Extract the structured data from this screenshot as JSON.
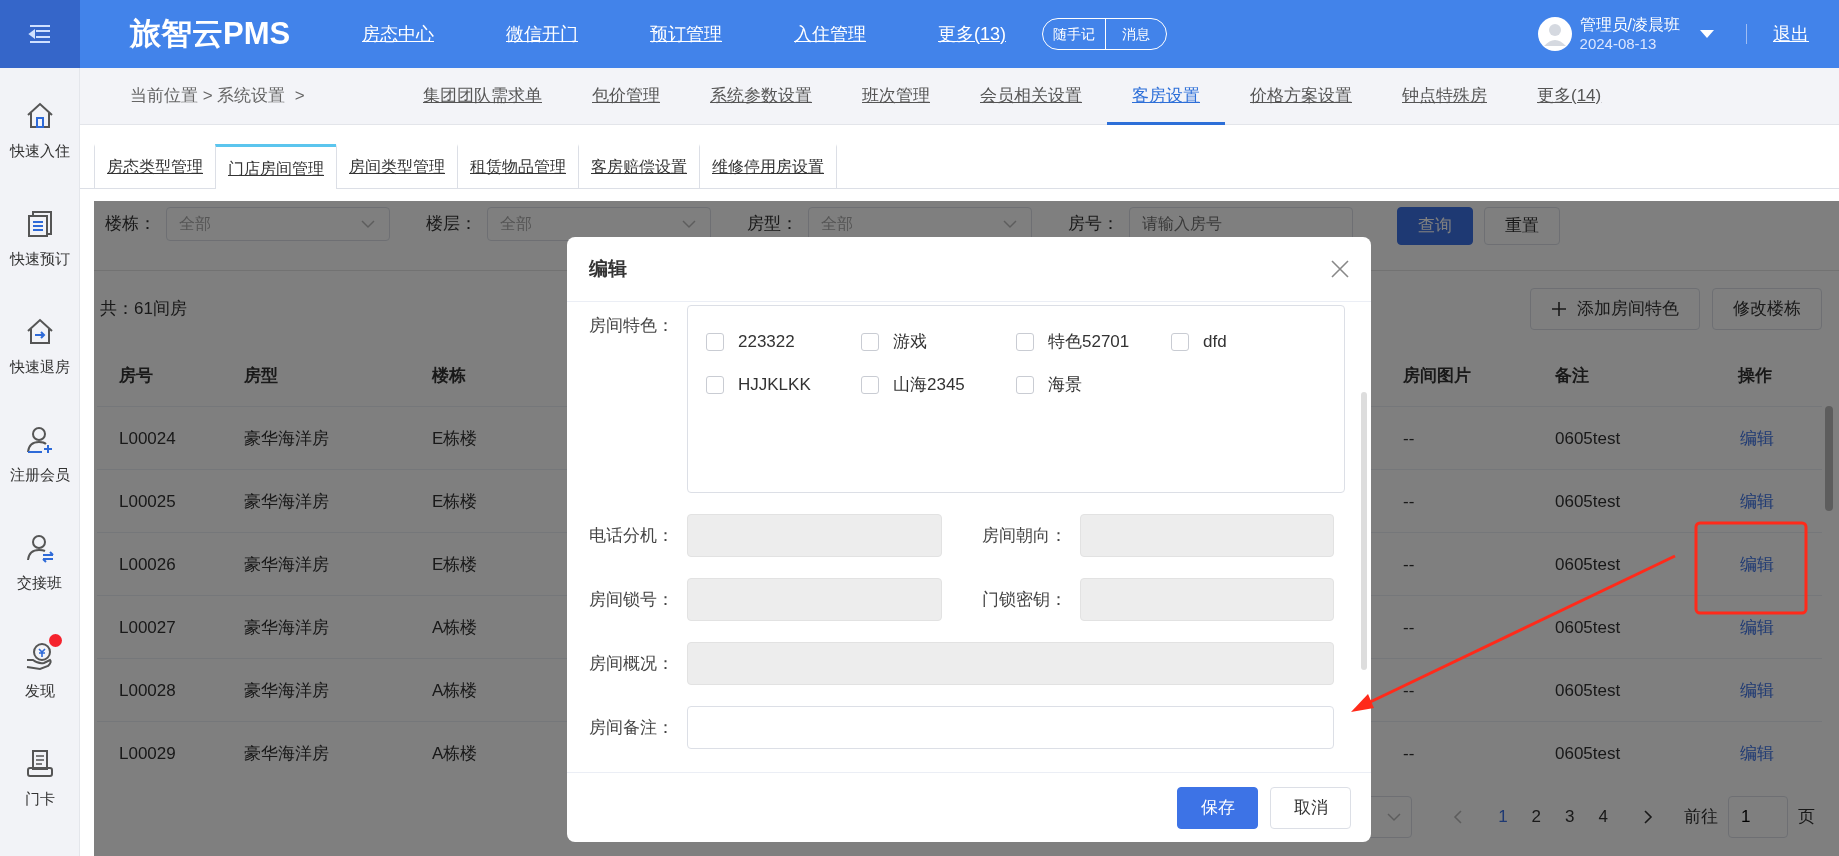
{
  "top_bar": {
    "logo": "旅智云PMS",
    "nav": [
      "房态中心",
      "微信开门",
      "预订管理",
      "入住管理",
      "更多(13)"
    ],
    "quick_buttons": [
      "随手记",
      "消息"
    ],
    "user": {
      "name": "管理员/凌晨班",
      "date": "2024-08-13"
    },
    "logout": "退出"
  },
  "sidebar": {
    "items": [
      {
        "label": "快速入住",
        "badge": false
      },
      {
        "label": "快速预订",
        "badge": false
      },
      {
        "label": "快速退房",
        "badge": false
      },
      {
        "label": "注册会员",
        "badge": false
      },
      {
        "label": "交接班",
        "badge": false
      },
      {
        "label": "发现",
        "badge": true
      },
      {
        "label": "门卡",
        "badge": false
      }
    ]
  },
  "breadcrumb": "当前位置 > 系统设置  >",
  "settings_tabs": [
    {
      "label": "集团团队需求单",
      "selected": false
    },
    {
      "label": "包价管理",
      "selected": false
    },
    {
      "label": "系统参数设置",
      "selected": false
    },
    {
      "label": "班次管理",
      "selected": false
    },
    {
      "label": "会员相关设置",
      "selected": false
    },
    {
      "label": "客房设置",
      "selected": true
    },
    {
      "label": "价格方案设置",
      "selected": false
    },
    {
      "label": "钟点特殊房",
      "selected": false
    },
    {
      "label": "更多(14)",
      "selected": false
    }
  ],
  "sub_tabs": [
    {
      "label": "房态类型管理",
      "selected": false
    },
    {
      "label": "门店房间管理",
      "selected": true
    },
    {
      "label": "房间类型管理",
      "selected": false
    },
    {
      "label": "租赁物品管理",
      "selected": false
    },
    {
      "label": "客房赔偿设置",
      "selected": false
    },
    {
      "label": "维修停用房设置",
      "selected": false
    }
  ],
  "filters": [
    {
      "kind": "select",
      "label": "楼栋：",
      "value": "全部"
    },
    {
      "kind": "select",
      "label": "楼层：",
      "value": "全部"
    },
    {
      "kind": "select",
      "label": "房型：",
      "value": "全部"
    },
    {
      "kind": "input",
      "label": "房号：",
      "placeholder": "请输入房号"
    }
  ],
  "filter_buttons": [
    {
      "kind": "primary",
      "label": "查询"
    },
    {
      "kind": "default",
      "label": "重置"
    }
  ],
  "total": "共：61间房",
  "toolbar_buttons": [
    {
      "kind": "add",
      "label": "添加房间特色"
    },
    {
      "kind": "plain",
      "label": "修改楼栋"
    }
  ],
  "table": {
    "columns": [
      "房号",
      "房型",
      "楼栋",
      "房间图片",
      "备注",
      "操作"
    ],
    "rows": [
      {
        "cells": [
          "L00024",
          "豪华海洋房",
          "E栋楼",
          "--",
          "0605test"
        ],
        "action": "编辑"
      },
      {
        "cells": [
          "L00025",
          "豪华海洋房",
          "E栋楼",
          "--",
          "0605test"
        ],
        "action": "编辑"
      },
      {
        "cells": [
          "L00026",
          "豪华海洋房",
          "E栋楼",
          "--",
          "0605test"
        ],
        "action": "编辑"
      },
      {
        "cells": [
          "L00027",
          "豪华海洋房",
          "A栋楼",
          "--",
          "0605test"
        ],
        "action": "编辑"
      },
      {
        "cells": [
          "L00028",
          "豪华海洋房",
          "A栋楼",
          "--",
          "0605test"
        ],
        "action": "编辑"
      },
      {
        "cells": [
          "L00029",
          "豪华海洋房",
          "A栋楼",
          "--",
          "0605test"
        ],
        "action": "编辑"
      }
    ]
  },
  "pagination": {
    "pages": [
      {
        "label": "1",
        "selected": true
      },
      {
        "label": "2",
        "selected": false
      },
      {
        "label": "3",
        "selected": false
      },
      {
        "label": "4",
        "selected": false
      }
    ],
    "goto_label": "前往",
    "goto_value": "1",
    "page_suffix": "页"
  },
  "modal": {
    "title": "编辑",
    "feature_label": "房间特色：",
    "features": [
      {
        "label": "223322",
        "checked": false
      },
      {
        "label": "游戏",
        "checked": false
      },
      {
        "label": "特色52701",
        "checked": false
      },
      {
        "label": "dfd",
        "checked": false
      },
      {
        "label": "HJJKLKK",
        "checked": false
      },
      {
        "label": "山海2345",
        "checked": false
      },
      {
        "label": "海景",
        "checked": false
      }
    ],
    "field_rows": [
      [
        {
          "label": "电话分机：",
          "disabled": true
        },
        {
          "label": "房间朝向：",
          "disabled": true
        }
      ],
      [
        {
          "label": "房间锁号：",
          "disabled": true
        },
        {
          "label": "门锁密钥：",
          "disabled": true
        }
      ],
      [
        {
          "label": "房间概况：",
          "disabled": true
        }
      ],
      [
        {
          "label": "房间备注：",
          "disabled": false
        }
      ]
    ],
    "buttons": [
      {
        "kind": "primary",
        "label": "保存"
      },
      {
        "kind": "default",
        "label": "取消"
      }
    ]
  }
}
